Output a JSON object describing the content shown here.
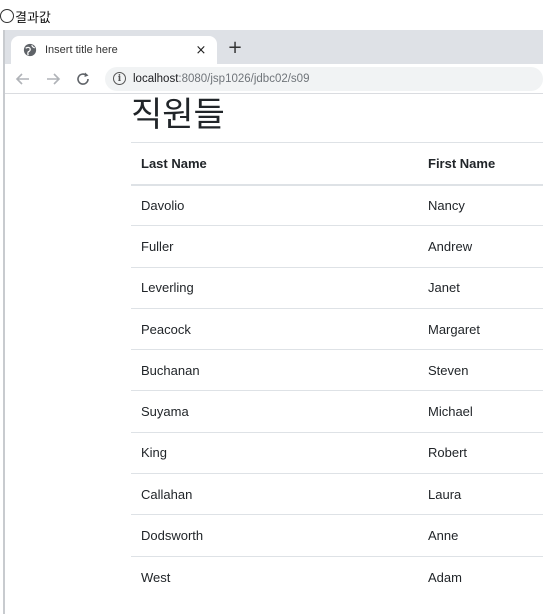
{
  "caption": "결과값",
  "browser": {
    "tab_title": "Insert title here",
    "tab_close": "×",
    "new_tab": "+",
    "url_host": "localhost",
    "url_path": ":8080/jsp1026/jdbc02/s09"
  },
  "page": {
    "title": "직원들",
    "columns": [
      "Last Name",
      "First Name"
    ],
    "rows": [
      [
        "Davolio",
        "Nancy"
      ],
      [
        "Fuller",
        "Andrew"
      ],
      [
        "Leverling",
        "Janet"
      ],
      [
        "Peacock",
        "Margaret"
      ],
      [
        "Buchanan",
        "Steven"
      ],
      [
        "Suyama",
        "Michael"
      ],
      [
        "King",
        "Robert"
      ],
      [
        "Callahan",
        "Laura"
      ],
      [
        "Dodsworth",
        "Anne"
      ],
      [
        "West",
        "Adam"
      ]
    ]
  }
}
